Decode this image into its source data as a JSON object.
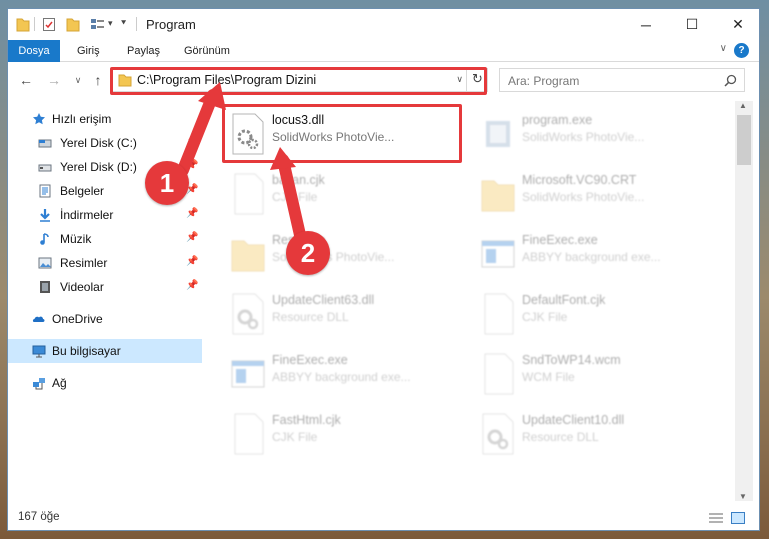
{
  "window": {
    "title": "Program"
  },
  "titlebar": {
    "minimize": "─",
    "maximize": "☐",
    "close": "✕"
  },
  "ribbon": {
    "tabs": [
      "Dosya",
      "Giriş",
      "Paylaş",
      "Görünüm"
    ],
    "expand_glyph": "∨",
    "help": "?"
  },
  "nav": {
    "address": "C:\\Program Files\\Program Dizini",
    "search_placeholder": "Ara: Program"
  },
  "sidebar": {
    "items": [
      {
        "label": "Hızlı erişim",
        "icon": "star-icon",
        "pinned": false
      },
      {
        "label": "Yerel Disk (C:)",
        "icon": "drive-icon",
        "pinned": true
      },
      {
        "label": "Yerel Disk (D:)",
        "icon": "drive-icon",
        "pinned": true
      },
      {
        "label": "Belgeler",
        "icon": "documents-icon",
        "pinned": true
      },
      {
        "label": "İndirmeler",
        "icon": "download-icon",
        "pinned": true
      },
      {
        "label": "Müzik",
        "icon": "music-icon",
        "pinned": true
      },
      {
        "label": "Resimler",
        "icon": "pictures-icon",
        "pinned": true
      },
      {
        "label": "Videolar",
        "icon": "video-icon",
        "pinned": true
      },
      {
        "label": "OneDrive",
        "icon": "onedrive-icon",
        "pinned": false
      },
      {
        "label": "Bu bilgisayar",
        "icon": "computer-icon",
        "pinned": false,
        "selected": true
      },
      {
        "label": "Ağ",
        "icon": "network-icon",
        "pinned": false
      }
    ]
  },
  "files": [
    {
      "name": "locus3.dll",
      "desc": "SolidWorks PhotoVie...",
      "icon": "dll-gear-icon",
      "highlighted": true
    },
    {
      "name": "program.exe",
      "desc": "SolidWorks PhotoVie...",
      "icon": "exe-icon"
    },
    {
      "name": "bacan.cjk",
      "desc": "CJK File",
      "icon": "blank-file-icon"
    },
    {
      "name": "Microsoft.VC90.CRT",
      "desc": "SolidWorks PhotoVie...",
      "icon": "folder-icon"
    },
    {
      "name": "Resource",
      "desc": "SolidWorks PhotoVie...",
      "icon": "folder-icon"
    },
    {
      "name": "FineExec.exe",
      "desc": "ABBYY background exe...",
      "icon": "window-exe-icon"
    },
    {
      "name": "UpdateClient63.dll",
      "desc": "Resource DLL",
      "icon": "dll-gear-icon"
    },
    {
      "name": "DefaultFont.cjk",
      "desc": "CJK File",
      "icon": "blank-file-icon"
    },
    {
      "name": "FineExec.exe",
      "desc": "ABBYY background exe...",
      "icon": "window-exe-icon"
    },
    {
      "name": "SndToWP14.wcm",
      "desc": "WCM File",
      "icon": "blank-file-icon"
    },
    {
      "name": "FastHtml.cjk",
      "desc": "CJK File",
      "icon": "blank-file-icon"
    },
    {
      "name": "UpdateClient10.dll",
      "desc": "Resource DLL",
      "icon": "dll-gear-icon"
    }
  ],
  "status": {
    "count": "167 öğe"
  },
  "annotations": {
    "step1": "1",
    "step2": "2",
    "accent": "#e5393b"
  }
}
